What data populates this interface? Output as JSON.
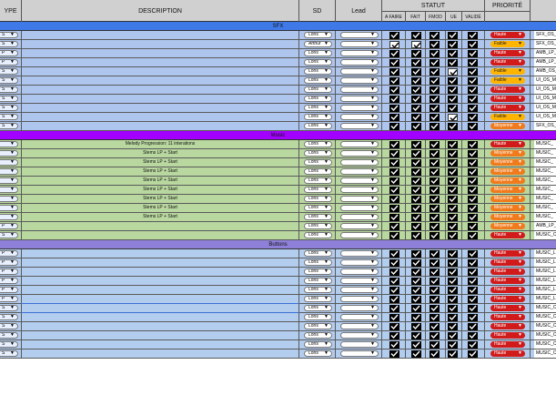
{
  "headers": {
    "type": "YPE",
    "description": "DESCRIPTION",
    "sd": "SD",
    "lead": "Lead",
    "statut": "STATUT",
    "statut_sub": [
      "A FAIRE",
      "FAIT",
      "FMOD",
      "UE",
      "VALIDÉ"
    ],
    "priorite": "PRIORITÉ"
  },
  "colors": {
    "sfx_bg": "#aec6ee",
    "sfx_bar": "#3f79e8",
    "music_bg": "#b9d8a0",
    "music_bar": "#a200ff",
    "buttons_bg": "#b3cdef",
    "buttons_bar": "#8e7fd8",
    "haute": "#d11a1a",
    "faible": "#ffb400",
    "moyenne": "#f07a1c"
  },
  "sections": [
    {
      "name": "SFX",
      "type_prefix": "S",
      "theme": "sfx",
      "rows": [
        {
          "t": "S",
          "desc": "",
          "sd": "Loris",
          "lead": "",
          "chk": [
            1,
            1,
            1,
            1,
            1
          ],
          "prio": "Haute",
          "code": "SFX_OS_"
        },
        {
          "t": "S",
          "desc": "",
          "sd": "Arthur",
          "lead": "",
          "chk": [
            0,
            0,
            1,
            1,
            1
          ],
          "prio": "Faible",
          "code": "SFX_OS_"
        },
        {
          "t": "P",
          "desc": "",
          "sd": "Loris",
          "lead": "",
          "chk": [
            1,
            1,
            1,
            1,
            1
          ],
          "prio": "Haute",
          "code": "AMB_LP_"
        },
        {
          "t": "P",
          "desc": "",
          "sd": "Loris",
          "lead": "",
          "chk": [
            1,
            1,
            1,
            1,
            1
          ],
          "prio": "Haute",
          "code": "AMB_LP_"
        },
        {
          "t": "S",
          "desc": "",
          "sd": "Loris",
          "lead": "",
          "chk": [
            1,
            1,
            1,
            0,
            1
          ],
          "prio": "Faible",
          "code": "AMB_OS_"
        },
        {
          "t": "S",
          "desc": "",
          "sd": "Loris",
          "lead": "",
          "chk": [
            1,
            1,
            1,
            1,
            1
          ],
          "prio": "Faible",
          "code": "UI_OS_M"
        },
        {
          "t": "S",
          "desc": "",
          "sd": "Loris",
          "lead": "",
          "chk": [
            1,
            1,
            1,
            1,
            1
          ],
          "prio": "Haute",
          "code": "UI_OS_M"
        },
        {
          "t": "S",
          "desc": "",
          "sd": "Loris",
          "lead": "",
          "chk": [
            1,
            1,
            1,
            1,
            1
          ],
          "prio": "Haute",
          "code": "UI_OS_M"
        },
        {
          "t": "S",
          "desc": "",
          "sd": "Loris",
          "lead": "",
          "chk": [
            1,
            1,
            1,
            1,
            1
          ],
          "prio": "Haute",
          "code": "UI_OS_M"
        },
        {
          "t": "S",
          "desc": "",
          "sd": "Loris",
          "lead": "",
          "chk": [
            1,
            1,
            1,
            0,
            1
          ],
          "prio": "Faible",
          "code": "UI_OS_M"
        },
        {
          "t": "S",
          "desc": "",
          "sd": "Loris",
          "lead": "",
          "chk": [
            1,
            1,
            1,
            1,
            1
          ],
          "prio": "Moyenne",
          "code": "SFX_OS_"
        }
      ]
    },
    {
      "name": "Music",
      "theme": "music",
      "rows": [
        {
          "t": "",
          "desc": "Melody Progression: 11 interations",
          "sd": "Loris",
          "lead": "",
          "chk": [
            1,
            1,
            1,
            1,
            1
          ],
          "prio": "Haute",
          "code": "MUSIC_"
        },
        {
          "t": "",
          "desc": "Stems LP + Start",
          "sd": "Loris",
          "lead": "",
          "chk": [
            1,
            1,
            1,
            1,
            1
          ],
          "prio": "Moyenne",
          "code": "MUSIC_"
        },
        {
          "t": "",
          "desc": "Stems LP + Start",
          "sd": "Loris",
          "lead": "",
          "chk": [
            1,
            1,
            1,
            1,
            1
          ],
          "prio": "Moyenne",
          "code": "MUSIC_"
        },
        {
          "t": "",
          "desc": "Stems LP + Start",
          "sd": "Loris",
          "lead": "",
          "chk": [
            1,
            1,
            1,
            1,
            1
          ],
          "prio": "Moyenne",
          "code": "MUSIC_"
        },
        {
          "t": "",
          "desc": "Stems LP + Start",
          "sd": "Loris",
          "lead": "",
          "chk": [
            1,
            1,
            1,
            1,
            1
          ],
          "prio": "Moyenne",
          "code": "MUSIC_"
        },
        {
          "t": "",
          "desc": "Stems LP + Start",
          "sd": "Loris",
          "lead": "",
          "chk": [
            1,
            1,
            1,
            1,
            1
          ],
          "prio": "Moyenne",
          "code": "MUSIC_"
        },
        {
          "t": "",
          "desc": "Stems LP + Start",
          "sd": "Loris",
          "lead": "",
          "chk": [
            1,
            1,
            1,
            1,
            1
          ],
          "prio": "Moyenne",
          "code": "MUSIC_"
        },
        {
          "t": "",
          "desc": "Stems LP + Start",
          "sd": "Loris",
          "lead": "",
          "chk": [
            1,
            1,
            1,
            1,
            1
          ],
          "prio": "Moyenne",
          "code": "MUSIC_"
        },
        {
          "t": "",
          "desc": "Stems LP + Start",
          "sd": "Loris",
          "lead": "",
          "chk": [
            1,
            1,
            1,
            1,
            1
          ],
          "prio": "Moyenne",
          "code": "MUSIC_"
        },
        {
          "t": "P",
          "desc": "",
          "sd": "Loris",
          "lead": "",
          "chk": [
            1,
            1,
            1,
            1,
            1
          ],
          "prio": "Moyenne",
          "code": "AMB_LP_"
        },
        {
          "t": "S",
          "desc": "",
          "sd": "Loris",
          "lead": "",
          "chk": [
            1,
            1,
            1,
            1,
            1
          ],
          "prio": "Haute",
          "code": "MUSIC_C"
        }
      ]
    },
    {
      "name": "Buttons",
      "theme": "buttons",
      "rows": [
        {
          "t": "P",
          "desc": "",
          "sd": "Loris",
          "lead": "",
          "chk": [
            1,
            1,
            1,
            1,
            1
          ],
          "prio": "Haute",
          "code": "MUSIC_L"
        },
        {
          "t": "P",
          "desc": "",
          "sd": "Loris",
          "lead": "",
          "chk": [
            1,
            1,
            1,
            1,
            1
          ],
          "prio": "Haute",
          "code": "MUSIC_L"
        },
        {
          "t": "P",
          "desc": "",
          "sd": "Loris",
          "lead": "",
          "chk": [
            1,
            1,
            1,
            1,
            1
          ],
          "prio": "Haute",
          "code": "MUSIC_L"
        },
        {
          "t": "P",
          "desc": "",
          "sd": "Loris",
          "lead": "",
          "chk": [
            1,
            1,
            1,
            1,
            1
          ],
          "prio": "Haute",
          "code": "MUSIC_L"
        },
        {
          "t": "P",
          "desc": "",
          "sd": "Loris",
          "lead": "",
          "chk": [
            1,
            1,
            1,
            1,
            1
          ],
          "prio": "Haute",
          "code": "MUSIC_L"
        },
        {
          "t": "P",
          "desc": "",
          "sd": "Loris",
          "lead": "",
          "chk": [
            1,
            1,
            1,
            1,
            1
          ],
          "prio": "Haute",
          "code": "MUSIC_L"
        },
        {
          "t": "S",
          "desc": "",
          "sd": "Loris",
          "lead": "",
          "chk": [
            1,
            1,
            1,
            1,
            1
          ],
          "prio": "Haute",
          "code": "MUSIC_C"
        },
        {
          "t": "S",
          "desc": "",
          "sd": "Loris",
          "lead": "",
          "chk": [
            1,
            1,
            1,
            1,
            1
          ],
          "prio": "Haute",
          "code": "MUSIC_C"
        },
        {
          "t": "S",
          "desc": "",
          "sd": "Loris",
          "lead": "",
          "chk": [
            1,
            1,
            1,
            1,
            1
          ],
          "prio": "Haute",
          "code": "MUSIC_C"
        },
        {
          "t": "S",
          "desc": "",
          "sd": "Loris",
          "lead": "",
          "chk": [
            1,
            1,
            1,
            1,
            1
          ],
          "prio": "Haute",
          "code": "MUSIC_C"
        },
        {
          "t": "S",
          "desc": "",
          "sd": "Loris",
          "lead": "",
          "chk": [
            1,
            1,
            1,
            1,
            1
          ],
          "prio": "Haute",
          "code": "MUSIC_C"
        },
        {
          "t": "S",
          "desc": "",
          "sd": "Loris",
          "lead": "",
          "chk": [
            1,
            1,
            1,
            1,
            1
          ],
          "prio": "Haute",
          "code": "MUSIC_C"
        }
      ]
    }
  ]
}
